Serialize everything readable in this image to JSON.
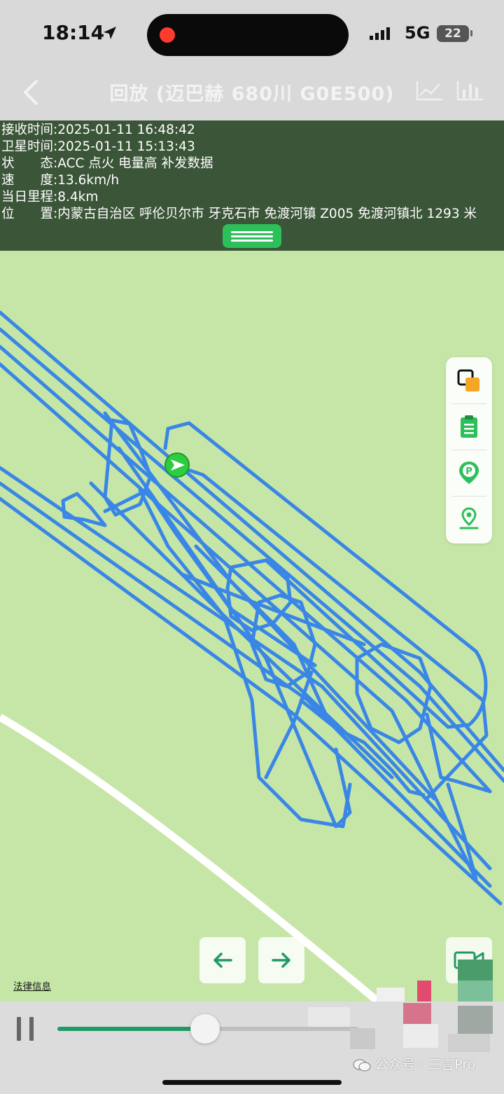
{
  "status_bar": {
    "time": "18:14",
    "network": "5G",
    "battery": "22",
    "recording_color": "#ff3b30"
  },
  "nav": {
    "title": "回放 (迈巴赫 680川 G0E500)",
    "back_icon": "chevron-left-icon",
    "right_icons": [
      "line-chart-icon",
      "bar-chart-icon"
    ]
  },
  "info": {
    "rows": [
      "接收时间:2025-01-11 16:48:42",
      "卫星时间:2025-01-11 15:13:43",
      "状　　态:ACC 点火 电量高 补发数据",
      "速　　度:13.6km/h",
      "当日里程:8.4km",
      "位　　置:内蒙古自治区 呼伦贝尔市 牙克石市 免渡河镇 Z005 免渡河镇北 1293 米"
    ],
    "collapse_icon": "menu-lines-icon",
    "panel_color": "#3b5538",
    "accent_color": "#2dbf59"
  },
  "map": {
    "background_color": "#c5e6a6",
    "track_color": "#3a86e6",
    "road_color": "#ffffff",
    "vehicle_marker_color": "#2ecc40",
    "tools": [
      "layers-icon",
      "clipboard-icon",
      "parking-pin-icon",
      "location-pin-icon"
    ]
  },
  "controls": {
    "prev_icon": "arrow-left-icon",
    "next_icon": "arrow-right-icon",
    "camera_icon": "video-camera-icon",
    "legal_text": "法律信息",
    "playback_progress_percent": 49
  },
  "watermark": {
    "text": "公众号 · 三言Pro",
    "icon": "wechat-icon"
  }
}
